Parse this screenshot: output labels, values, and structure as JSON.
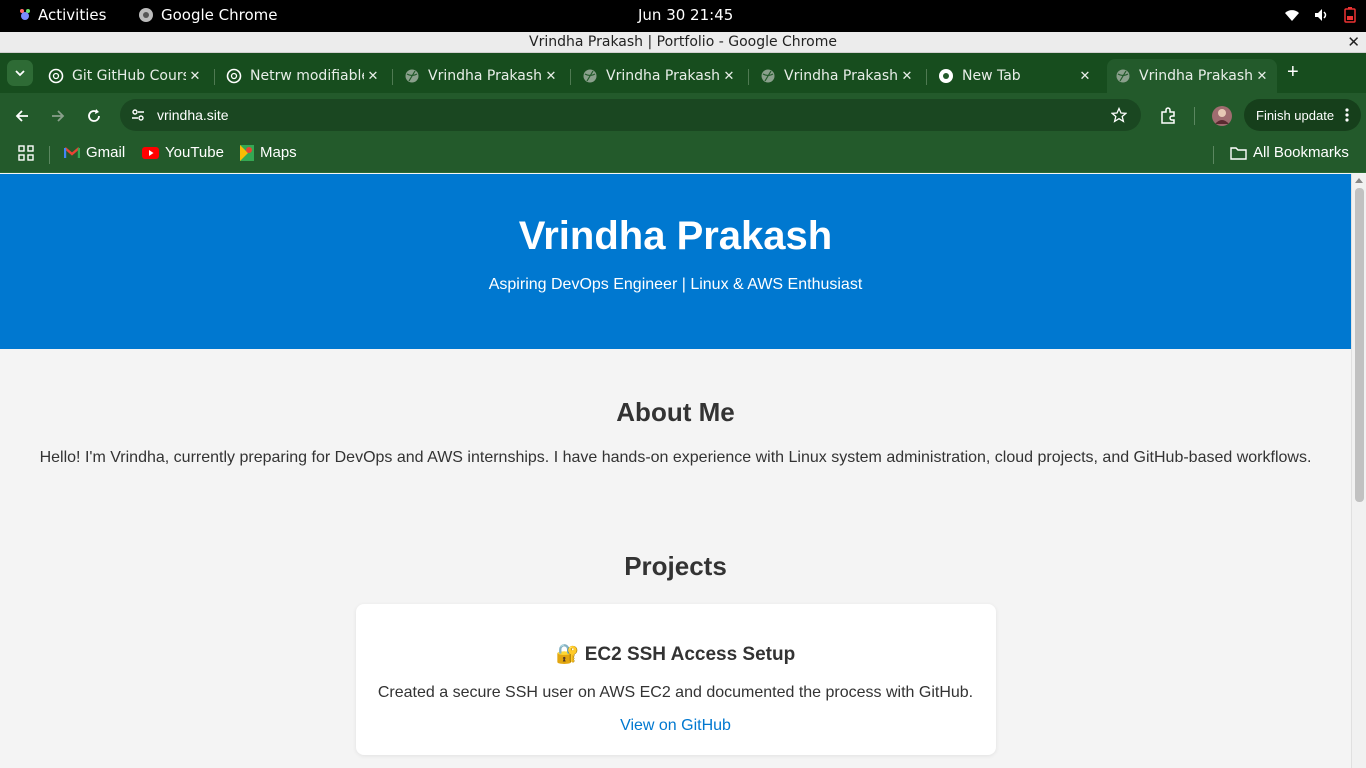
{
  "system_bar": {
    "activities": "Activities",
    "app_name": "Google Chrome",
    "clock": "Jun 30  21:45"
  },
  "window": {
    "title": "Vrindha Prakash | Portfolio - Google Chrome"
  },
  "tabs": [
    {
      "title": "Git GitHub Course",
      "favicon": "openai-icon"
    },
    {
      "title": "Netrw modifiable",
      "favicon": "openai-icon"
    },
    {
      "title": "Vrindha Prakash",
      "favicon": "globe-icon"
    },
    {
      "title": "Vrindha Prakash",
      "favicon": "globe-icon"
    },
    {
      "title": "Vrindha Prakash",
      "favicon": "globe-icon"
    },
    {
      "title": "New Tab",
      "favicon": "chrome-icon"
    },
    {
      "title": "Vrindha Prakash",
      "favicon": "globe-icon",
      "active": true
    }
  ],
  "toolbar": {
    "url": "vrindha.site",
    "finish_update": "Finish update"
  },
  "bookmarks": {
    "items": [
      {
        "label": "Gmail"
      },
      {
        "label": "YouTube"
      },
      {
        "label": "Maps"
      }
    ],
    "all_bookmarks": "All Bookmarks"
  },
  "page": {
    "hero": {
      "name": "Vrindha Prakash",
      "tagline": "Aspiring DevOps Engineer | Linux & AWS Enthusiast"
    },
    "about": {
      "heading": "About Me",
      "text": "Hello! I'm Vrindha, currently preparing for DevOps and AWS internships. I have hands-on experience with Linux system administration, cloud projects, and GitHub-based workflows."
    },
    "projects": {
      "heading": "Projects",
      "items": [
        {
          "title": "🔐 EC2 SSH Access Setup",
          "description": "Created a secure SSH user on AWS EC2 and documented the process with GitHub.",
          "link": "View on GitHub"
        }
      ]
    }
  },
  "colors": {
    "hero": "#0078d0",
    "tabstrip": "#174d1e",
    "toolbar": "#235a2b",
    "link": "#0078d0"
  }
}
